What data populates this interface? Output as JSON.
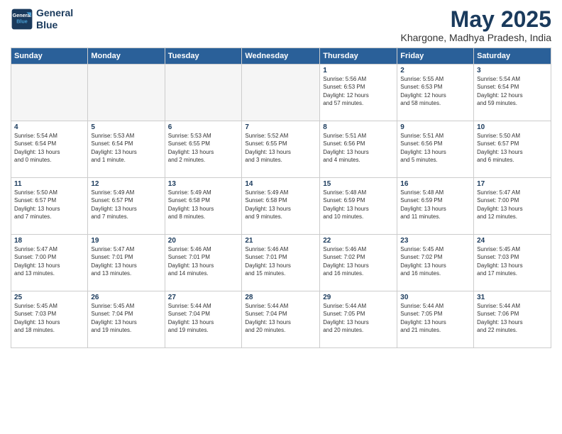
{
  "logo": {
    "line1": "General",
    "line2": "Blue"
  },
  "title": "May 2025",
  "location": "Khargone, Madhya Pradesh, India",
  "days_header": [
    "Sunday",
    "Monday",
    "Tuesday",
    "Wednesday",
    "Thursday",
    "Friday",
    "Saturday"
  ],
  "weeks": [
    [
      {
        "day": "",
        "info": ""
      },
      {
        "day": "",
        "info": ""
      },
      {
        "day": "",
        "info": ""
      },
      {
        "day": "",
        "info": ""
      },
      {
        "day": "1",
        "info": "Sunrise: 5:56 AM\nSunset: 6:53 PM\nDaylight: 12 hours\nand 57 minutes."
      },
      {
        "day": "2",
        "info": "Sunrise: 5:55 AM\nSunset: 6:53 PM\nDaylight: 12 hours\nand 58 minutes."
      },
      {
        "day": "3",
        "info": "Sunrise: 5:54 AM\nSunset: 6:54 PM\nDaylight: 12 hours\nand 59 minutes."
      }
    ],
    [
      {
        "day": "4",
        "info": "Sunrise: 5:54 AM\nSunset: 6:54 PM\nDaylight: 13 hours\nand 0 minutes."
      },
      {
        "day": "5",
        "info": "Sunrise: 5:53 AM\nSunset: 6:54 PM\nDaylight: 13 hours\nand 1 minute."
      },
      {
        "day": "6",
        "info": "Sunrise: 5:53 AM\nSunset: 6:55 PM\nDaylight: 13 hours\nand 2 minutes."
      },
      {
        "day": "7",
        "info": "Sunrise: 5:52 AM\nSunset: 6:55 PM\nDaylight: 13 hours\nand 3 minutes."
      },
      {
        "day": "8",
        "info": "Sunrise: 5:51 AM\nSunset: 6:56 PM\nDaylight: 13 hours\nand 4 minutes."
      },
      {
        "day": "9",
        "info": "Sunrise: 5:51 AM\nSunset: 6:56 PM\nDaylight: 13 hours\nand 5 minutes."
      },
      {
        "day": "10",
        "info": "Sunrise: 5:50 AM\nSunset: 6:57 PM\nDaylight: 13 hours\nand 6 minutes."
      }
    ],
    [
      {
        "day": "11",
        "info": "Sunrise: 5:50 AM\nSunset: 6:57 PM\nDaylight: 13 hours\nand 7 minutes."
      },
      {
        "day": "12",
        "info": "Sunrise: 5:49 AM\nSunset: 6:57 PM\nDaylight: 13 hours\nand 7 minutes."
      },
      {
        "day": "13",
        "info": "Sunrise: 5:49 AM\nSunset: 6:58 PM\nDaylight: 13 hours\nand 8 minutes."
      },
      {
        "day": "14",
        "info": "Sunrise: 5:49 AM\nSunset: 6:58 PM\nDaylight: 13 hours\nand 9 minutes."
      },
      {
        "day": "15",
        "info": "Sunrise: 5:48 AM\nSunset: 6:59 PM\nDaylight: 13 hours\nand 10 minutes."
      },
      {
        "day": "16",
        "info": "Sunrise: 5:48 AM\nSunset: 6:59 PM\nDaylight: 13 hours\nand 11 minutes."
      },
      {
        "day": "17",
        "info": "Sunrise: 5:47 AM\nSunset: 7:00 PM\nDaylight: 13 hours\nand 12 minutes."
      }
    ],
    [
      {
        "day": "18",
        "info": "Sunrise: 5:47 AM\nSunset: 7:00 PM\nDaylight: 13 hours\nand 13 minutes."
      },
      {
        "day": "19",
        "info": "Sunrise: 5:47 AM\nSunset: 7:01 PM\nDaylight: 13 hours\nand 13 minutes."
      },
      {
        "day": "20",
        "info": "Sunrise: 5:46 AM\nSunset: 7:01 PM\nDaylight: 13 hours\nand 14 minutes."
      },
      {
        "day": "21",
        "info": "Sunrise: 5:46 AM\nSunset: 7:01 PM\nDaylight: 13 hours\nand 15 minutes."
      },
      {
        "day": "22",
        "info": "Sunrise: 5:46 AM\nSunset: 7:02 PM\nDaylight: 13 hours\nand 16 minutes."
      },
      {
        "day": "23",
        "info": "Sunrise: 5:45 AM\nSunset: 7:02 PM\nDaylight: 13 hours\nand 16 minutes."
      },
      {
        "day": "24",
        "info": "Sunrise: 5:45 AM\nSunset: 7:03 PM\nDaylight: 13 hours\nand 17 minutes."
      }
    ],
    [
      {
        "day": "25",
        "info": "Sunrise: 5:45 AM\nSunset: 7:03 PM\nDaylight: 13 hours\nand 18 minutes."
      },
      {
        "day": "26",
        "info": "Sunrise: 5:45 AM\nSunset: 7:04 PM\nDaylight: 13 hours\nand 19 minutes."
      },
      {
        "day": "27",
        "info": "Sunrise: 5:44 AM\nSunset: 7:04 PM\nDaylight: 13 hours\nand 19 minutes."
      },
      {
        "day": "28",
        "info": "Sunrise: 5:44 AM\nSunset: 7:04 PM\nDaylight: 13 hours\nand 20 minutes."
      },
      {
        "day": "29",
        "info": "Sunrise: 5:44 AM\nSunset: 7:05 PM\nDaylight: 13 hours\nand 20 minutes."
      },
      {
        "day": "30",
        "info": "Sunrise: 5:44 AM\nSunset: 7:05 PM\nDaylight: 13 hours\nand 21 minutes."
      },
      {
        "day": "31",
        "info": "Sunrise: 5:44 AM\nSunset: 7:06 PM\nDaylight: 13 hours\nand 22 minutes."
      }
    ]
  ]
}
